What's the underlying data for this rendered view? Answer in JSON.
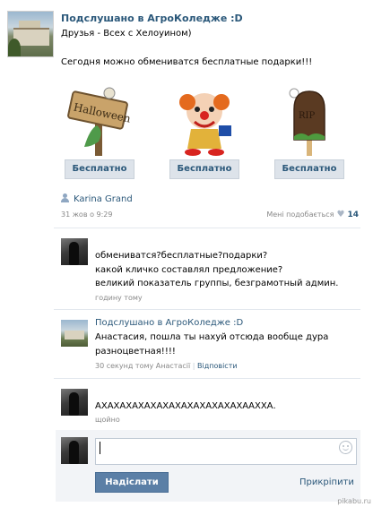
{
  "post": {
    "group_name": "Подслушано в АгроКоледже :D",
    "friends_line": "Друзья - Всех с Хелоуином)",
    "body": "Сегодня можно обмениватся бесплатные подарки!!!",
    "gifts": [
      {
        "name": "halloween-sign-gift",
        "button": "Бесплатно",
        "sign_text": "Halloween"
      },
      {
        "name": "clown-gift",
        "button": "Бесплатно"
      },
      {
        "name": "rip-icecream-gift",
        "button": "Бесплатно",
        "sign_text": "RIP"
      }
    ],
    "author": "Karina Grand",
    "date": "31 жов о 9:29",
    "like_label": "Мені подобається",
    "like_count": "14"
  },
  "comments": [
    {
      "lines": [
        "обмениватся?бесплатные?подарки?",
        "какой кличко составлял предложение?",
        "великий показатель группы, безграмотный админ."
      ],
      "meta": "годину тому"
    },
    {
      "author": "Подслушано в АгроКоледже :D",
      "lines": [
        "Анастасия, пошла ты нахуй отсюда вообще дура",
        "разноцветная!!!!"
      ],
      "meta": "30 секунд тому Анастасії",
      "reply": "Відповісти"
    },
    {
      "lines": [
        "АХАХАХАХАХАХАХАХАХАХАХАХААХХА."
      ],
      "meta": "щойно"
    }
  ],
  "reply_form": {
    "input_value": "",
    "send_label": "Надіслати",
    "attach_label": "Прикріпити"
  },
  "watermark": "pikabu.ru",
  "colors": {
    "link": "#2b587a",
    "button": "#5b7fa6",
    "free_button_bg": "#dde3ea"
  }
}
